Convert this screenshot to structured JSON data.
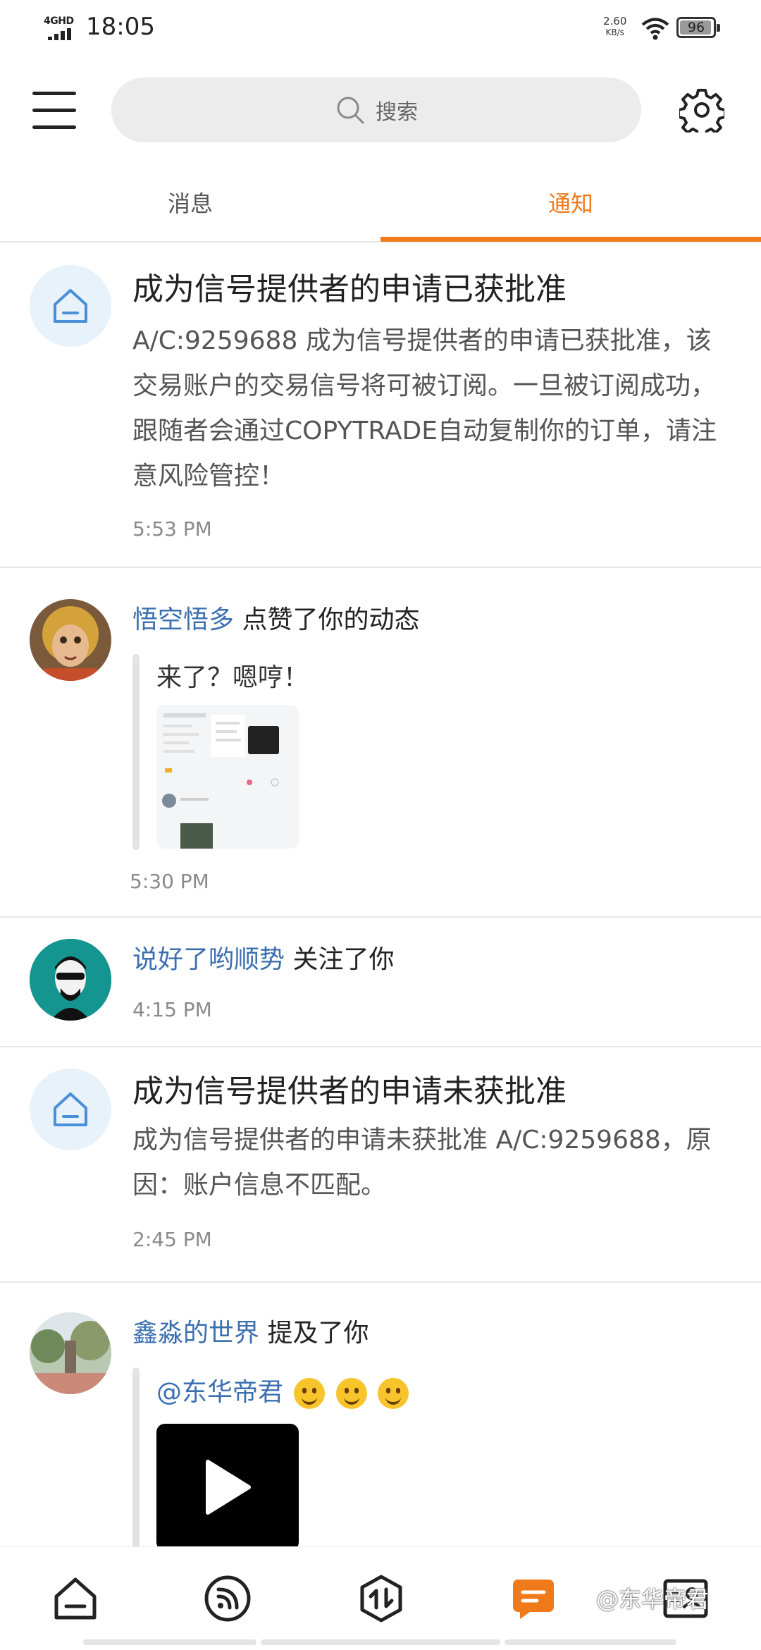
{
  "status_bar": {
    "network": "4GHD",
    "time": "18:05",
    "speed_value": "2.60",
    "speed_unit": "KB/s",
    "battery_level": 96,
    "battery_label": "96"
  },
  "header": {
    "search_placeholder": "搜索"
  },
  "tabs": [
    {
      "label": "消息",
      "active": false
    },
    {
      "label": "通知",
      "active": true
    }
  ],
  "notifications": [
    {
      "type": "system",
      "title": "成为信号提供者的申请已获批准",
      "body": "A/C:9259688 成为信号提供者的申请已获批准，该交易账户的交易信号将可被订阅。一旦被订阅成功，跟随者会通过COPYTRADE自动复制你的订单，请注意风险管控！",
      "time": "5:53 PM"
    },
    {
      "type": "like",
      "user": "悟空悟多",
      "action": "点赞了你的动态",
      "quote": "来了？嗯哼！",
      "time": "5:30 PM"
    },
    {
      "type": "follow",
      "user": "说好了哟顺势",
      "action": "关注了你",
      "time": "4:15 PM"
    },
    {
      "type": "system",
      "title": "成为信号提供者的申请未获批准",
      "body": "成为信号提供者的申请未获批准 A/C:9259688，原因：账户信息不匹配。",
      "time": "2:45 PM"
    },
    {
      "type": "mention",
      "user": "鑫淼的世界",
      "action": "提及了你",
      "quote": "@东华帝君"
    }
  ],
  "watermark": "@东华帝君",
  "colors": {
    "accent": "#f07a1a",
    "username": "#3b6fb0",
    "system_icon_bg": "#e8f2fb",
    "system_icon": "#4a90d9"
  },
  "icons": {
    "nav": [
      "home-icon",
      "feed-icon",
      "trade-icon",
      "messages-icon",
      "profile-card-icon"
    ]
  }
}
